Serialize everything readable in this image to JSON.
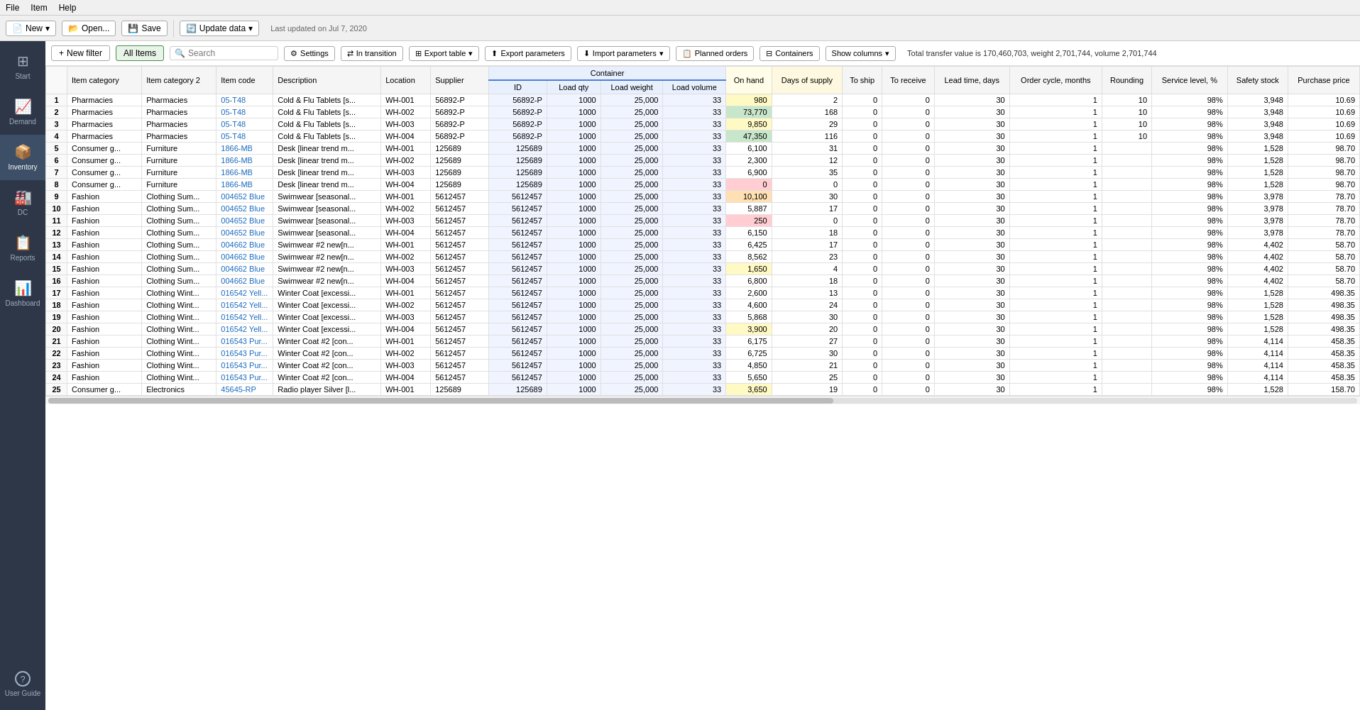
{
  "menu": {
    "file": "File",
    "item": "Item",
    "help": "Help"
  },
  "toolbar": {
    "new_label": "New",
    "open_label": "Open...",
    "save_label": "Save",
    "update_label": "Update data",
    "last_updated": "Last updated on Jul 7, 2020"
  },
  "sidebar": {
    "items": [
      {
        "id": "start",
        "label": "Start",
        "icon": "⊞"
      },
      {
        "id": "demand",
        "label": "Demand",
        "icon": "📈"
      },
      {
        "id": "inventory",
        "label": "Inventory",
        "icon": "📦",
        "active": true
      },
      {
        "id": "dc",
        "label": "DC",
        "icon": "🏭"
      },
      {
        "id": "reports",
        "label": "Reports",
        "icon": "📋"
      },
      {
        "id": "dashboard",
        "label": "Dashboard",
        "icon": "📊"
      }
    ],
    "bottom": [
      {
        "id": "user-guide",
        "label": "User Guide",
        "icon": "?"
      }
    ]
  },
  "filter_bar": {
    "new_filter": "New filter",
    "all_items": "All Items",
    "search_placeholder": "Search",
    "settings": "Settings",
    "in_transition": "In transition",
    "export_table": "Export table",
    "export_params": "Export parameters",
    "import_params": "Import parameters",
    "planned_orders": "Planned orders",
    "containers": "Containers",
    "show_columns": "Show columns",
    "info_text": "Total transfer value is 170,460,703, weight 2,701,744, volume 2,701,744"
  },
  "table": {
    "headers": {
      "row_num": "#",
      "item_category": "Item category",
      "item_category2": "Item category 2",
      "item_code": "Item code",
      "description": "Description",
      "location": "Location",
      "supplier": "Supplier",
      "container_label": "Container",
      "container_id": "ID",
      "load_qty": "Load qty",
      "load_weight": "Load weight",
      "load_volume": "Load volume",
      "on_hand": "On hand",
      "days_supply": "Days of supply",
      "to_ship": "To ship",
      "to_receive": "To receive",
      "lead_time": "Lead time, days",
      "order_cycle": "Order cycle, months",
      "rounding": "Rounding",
      "service_level": "Service level, %",
      "safety_stock": "Safety stock",
      "purchase_price": "Purchase price"
    },
    "rows": [
      {
        "num": 1,
        "cat": "Pharmacies",
        "cat2": "Pharmacies",
        "code": "05-T48",
        "desc": "Cold & Flu Tablets [s...",
        "loc": "WH-001",
        "sup": "56892-P",
        "cid": "56892-P",
        "lq": "1000",
        "lw": "25,000",
        "lv": "33",
        "on_hand": 980,
        "on_hand_color": "yellow",
        "days": 2,
        "ship": 0,
        "receive": 0,
        "lead": 30,
        "order": 1,
        "round": 10,
        "svc": "98%",
        "safety": 3948,
        "price": "10.69"
      },
      {
        "num": 2,
        "cat": "Pharmacies",
        "cat2": "Pharmacies",
        "code": "05-T48",
        "desc": "Cold & Flu Tablets [s...",
        "loc": "WH-002",
        "sup": "56892-P",
        "cid": "56892-P",
        "lq": "1000",
        "lw": "25,000",
        "lv": "33",
        "on_hand": 73770,
        "on_hand_color": "green",
        "days": 168,
        "ship": 0,
        "receive": 0,
        "lead": 30,
        "order": 1,
        "round": 10,
        "svc": "98%",
        "safety": 3948,
        "price": "10.69"
      },
      {
        "num": 3,
        "cat": "Pharmacies",
        "cat2": "Pharmacies",
        "code": "05-T48",
        "desc": "Cold & Flu Tablets [s...",
        "loc": "WH-003",
        "sup": "56892-P",
        "cid": "56892-P",
        "lq": "1000",
        "lw": "25,000",
        "lv": "33",
        "on_hand": 9850,
        "on_hand_color": "yellow",
        "days": 29,
        "ship": 0,
        "receive": 0,
        "lead": 30,
        "order": 1,
        "round": 10,
        "svc": "98%",
        "safety": 3948,
        "price": "10.69"
      },
      {
        "num": 4,
        "cat": "Pharmacies",
        "cat2": "Pharmacies",
        "code": "05-T48",
        "desc": "Cold & Flu Tablets [s...",
        "loc": "WH-004",
        "sup": "56892-P",
        "cid": "56892-P",
        "lq": "1000",
        "lw": "25,000",
        "lv": "33",
        "on_hand": 47350,
        "on_hand_color": "green",
        "days": 116,
        "ship": 0,
        "receive": 0,
        "lead": 30,
        "order": 1,
        "round": 10,
        "svc": "98%",
        "safety": 3948,
        "price": "10.69"
      },
      {
        "num": 5,
        "cat": "Consumer g...",
        "cat2": "Furniture",
        "code": "1866-MB",
        "desc": "Desk [linear trend m...",
        "loc": "WH-001",
        "sup": "125689",
        "cid": "125689",
        "lq": "1000",
        "lw": "25,000",
        "lv": "33",
        "on_hand": 6100,
        "on_hand_color": "white",
        "days": 31,
        "ship": 0,
        "receive": 0,
        "lead": 30,
        "order": 1,
        "round": "",
        "svc": "98%",
        "safety": 1528,
        "price": "98.70"
      },
      {
        "num": 6,
        "cat": "Consumer g...",
        "cat2": "Furniture",
        "code": "1866-MB",
        "desc": "Desk [linear trend m...",
        "loc": "WH-002",
        "sup": "125689",
        "cid": "125689",
        "lq": "1000",
        "lw": "25,000",
        "lv": "33",
        "on_hand": 2300,
        "on_hand_color": "white",
        "days": 12,
        "ship": 0,
        "receive": 0,
        "lead": 30,
        "order": 1,
        "round": "",
        "svc": "98%",
        "safety": 1528,
        "price": "98.70"
      },
      {
        "num": 7,
        "cat": "Consumer g...",
        "cat2": "Furniture",
        "code": "1866-MB",
        "desc": "Desk [linear trend m...",
        "loc": "WH-003",
        "sup": "125689",
        "cid": "125689",
        "lq": "1000",
        "lw": "25,000",
        "lv": "33",
        "on_hand": 6900,
        "on_hand_color": "white",
        "days": 35,
        "ship": 0,
        "receive": 0,
        "lead": 30,
        "order": 1,
        "round": "",
        "svc": "98%",
        "safety": 1528,
        "price": "98.70"
      },
      {
        "num": 8,
        "cat": "Consumer g...",
        "cat2": "Furniture",
        "code": "1866-MB",
        "desc": "Desk [linear trend m...",
        "loc": "WH-004",
        "sup": "125689",
        "cid": "125689",
        "lq": "1000",
        "lw": "25,000",
        "lv": "33",
        "on_hand": 0,
        "on_hand_color": "red",
        "days": 0,
        "ship": 0,
        "receive": 0,
        "lead": 30,
        "order": 1,
        "round": "",
        "svc": "98%",
        "safety": 1528,
        "price": "98.70"
      },
      {
        "num": 9,
        "cat": "Fashion",
        "cat2": "Clothing Sum...",
        "code": "004652 Blue",
        "desc": "Swimwear [seasonal...",
        "loc": "WH-001",
        "sup": "5612457",
        "cid": "5612457",
        "lq": "1000",
        "lw": "25,000",
        "lv": "33",
        "on_hand": 10100,
        "on_hand_color": "orange",
        "days": 30,
        "ship": 0,
        "receive": 0,
        "lead": 30,
        "order": 1,
        "round": "",
        "svc": "98%",
        "safety": 3978,
        "price": "78.70"
      },
      {
        "num": 10,
        "cat": "Fashion",
        "cat2": "Clothing Sum...",
        "code": "004652 Blue",
        "desc": "Swimwear [seasonal...",
        "loc": "WH-002",
        "sup": "5612457",
        "cid": "5612457",
        "lq": "1000",
        "lw": "25,000",
        "lv": "33",
        "on_hand": 5887,
        "on_hand_color": "white",
        "days": 17,
        "ship": 0,
        "receive": 0,
        "lead": 30,
        "order": 1,
        "round": "",
        "svc": "98%",
        "safety": 3978,
        "price": "78.70"
      },
      {
        "num": 11,
        "cat": "Fashion",
        "cat2": "Clothing Sum...",
        "code": "004652 Blue",
        "desc": "Swimwear [seasonal...",
        "loc": "WH-003",
        "sup": "5612457",
        "cid": "5612457",
        "lq": "1000",
        "lw": "25,000",
        "lv": "33",
        "on_hand": 250,
        "on_hand_color": "red",
        "days": 0,
        "ship": 0,
        "receive": 0,
        "lead": 30,
        "order": 1,
        "round": "",
        "svc": "98%",
        "safety": 3978,
        "price": "78.70"
      },
      {
        "num": 12,
        "cat": "Fashion",
        "cat2": "Clothing Sum...",
        "code": "004652 Blue",
        "desc": "Swimwear [seasonal...",
        "loc": "WH-004",
        "sup": "5612457",
        "cid": "5612457",
        "lq": "1000",
        "lw": "25,000",
        "lv": "33",
        "on_hand": 6150,
        "on_hand_color": "white",
        "days": 18,
        "ship": 0,
        "receive": 0,
        "lead": 30,
        "order": 1,
        "round": "",
        "svc": "98%",
        "safety": 3978,
        "price": "78.70"
      },
      {
        "num": 13,
        "cat": "Fashion",
        "cat2": "Clothing Sum...",
        "code": "004662 Blue",
        "desc": "Swimwear #2 new[n...",
        "loc": "WH-001",
        "sup": "5612457",
        "cid": "5612457",
        "lq": "1000",
        "lw": "25,000",
        "lv": "33",
        "on_hand": 6425,
        "on_hand_color": "white",
        "days": 17,
        "ship": 0,
        "receive": 0,
        "lead": 30,
        "order": 1,
        "round": "",
        "svc": "98%",
        "safety": 4402,
        "price": "58.70"
      },
      {
        "num": 14,
        "cat": "Fashion",
        "cat2": "Clothing Sum...",
        "code": "004662 Blue",
        "desc": "Swimwear #2 new[n...",
        "loc": "WH-002",
        "sup": "5612457",
        "cid": "5612457",
        "lq": "1000",
        "lw": "25,000",
        "lv": "33",
        "on_hand": 8562,
        "on_hand_color": "white",
        "days": 23,
        "ship": 0,
        "receive": 0,
        "lead": 30,
        "order": 1,
        "round": "",
        "svc": "98%",
        "safety": 4402,
        "price": "58.70"
      },
      {
        "num": 15,
        "cat": "Fashion",
        "cat2": "Clothing Sum...",
        "code": "004662 Blue",
        "desc": "Swimwear #2 new[n...",
        "loc": "WH-003",
        "sup": "5612457",
        "cid": "5612457",
        "lq": "1000",
        "lw": "25,000",
        "lv": "33",
        "on_hand": 1650,
        "on_hand_color": "yellow",
        "days": 4,
        "ship": 0,
        "receive": 0,
        "lead": 30,
        "order": 1,
        "round": "",
        "svc": "98%",
        "safety": 4402,
        "price": "58.70"
      },
      {
        "num": 16,
        "cat": "Fashion",
        "cat2": "Clothing Sum...",
        "code": "004662 Blue",
        "desc": "Swimwear #2 new[n...",
        "loc": "WH-004",
        "sup": "5612457",
        "cid": "5612457",
        "lq": "1000",
        "lw": "25,000",
        "lv": "33",
        "on_hand": 6800,
        "on_hand_color": "white",
        "days": 18,
        "ship": 0,
        "receive": 0,
        "lead": 30,
        "order": 1,
        "round": "",
        "svc": "98%",
        "safety": 4402,
        "price": "58.70"
      },
      {
        "num": 17,
        "cat": "Fashion",
        "cat2": "Clothing Wint...",
        "code": "016542 Yell...",
        "desc": "Winter Coat [excessi...",
        "loc": "WH-001",
        "sup": "5612457",
        "cid": "5612457",
        "lq": "1000",
        "lw": "25,000",
        "lv": "33",
        "on_hand": 2600,
        "on_hand_color": "white",
        "days": 13,
        "ship": 0,
        "receive": 0,
        "lead": 30,
        "order": 1,
        "round": "",
        "svc": "98%",
        "safety": 1528,
        "price": "498.35"
      },
      {
        "num": 18,
        "cat": "Fashion",
        "cat2": "Clothing Wint...",
        "code": "016542 Yell...",
        "desc": "Winter Coat [excessi...",
        "loc": "WH-002",
        "sup": "5612457",
        "cid": "5612457",
        "lq": "1000",
        "lw": "25,000",
        "lv": "33",
        "on_hand": 4600,
        "on_hand_color": "white",
        "days": 24,
        "ship": 0,
        "receive": 0,
        "lead": 30,
        "order": 1,
        "round": "",
        "svc": "98%",
        "safety": 1528,
        "price": "498.35"
      },
      {
        "num": 19,
        "cat": "Fashion",
        "cat2": "Clothing Wint...",
        "code": "016542 Yell...",
        "desc": "Winter Coat [excessi...",
        "loc": "WH-003",
        "sup": "5612457",
        "cid": "5612457",
        "lq": "1000",
        "lw": "25,000",
        "lv": "33",
        "on_hand": 5868,
        "on_hand_color": "white",
        "days": 30,
        "ship": 0,
        "receive": 0,
        "lead": 30,
        "order": 1,
        "round": "",
        "svc": "98%",
        "safety": 1528,
        "price": "498.35"
      },
      {
        "num": 20,
        "cat": "Fashion",
        "cat2": "Clothing Wint...",
        "code": "016542 Yell...",
        "desc": "Winter Coat [excessi...",
        "loc": "WH-004",
        "sup": "5612457",
        "cid": "5612457",
        "lq": "1000",
        "lw": "25,000",
        "lv": "33",
        "on_hand": 3900,
        "on_hand_color": "yellow",
        "days": 20,
        "ship": 0,
        "receive": 0,
        "lead": 30,
        "order": 1,
        "round": "",
        "svc": "98%",
        "safety": 1528,
        "price": "498.35"
      },
      {
        "num": 21,
        "cat": "Fashion",
        "cat2": "Clothing Wint...",
        "code": "016543 Pur...",
        "desc": "Winter Coat #2 [con...",
        "loc": "WH-001",
        "sup": "5612457",
        "cid": "5612457",
        "lq": "1000",
        "lw": "25,000",
        "lv": "33",
        "on_hand": 6175,
        "on_hand_color": "white",
        "days": 27,
        "ship": 0,
        "receive": 0,
        "lead": 30,
        "order": 1,
        "round": "",
        "svc": "98%",
        "safety": 4114,
        "price": "458.35"
      },
      {
        "num": 22,
        "cat": "Fashion",
        "cat2": "Clothing Wint...",
        "code": "016543 Pur...",
        "desc": "Winter Coat #2 [con...",
        "loc": "WH-002",
        "sup": "5612457",
        "cid": "5612457",
        "lq": "1000",
        "lw": "25,000",
        "lv": "33",
        "on_hand": 6725,
        "on_hand_color": "white",
        "days": 30,
        "ship": 0,
        "receive": 0,
        "lead": 30,
        "order": 1,
        "round": "",
        "svc": "98%",
        "safety": 4114,
        "price": "458.35"
      },
      {
        "num": 23,
        "cat": "Fashion",
        "cat2": "Clothing Wint...",
        "code": "016543 Pur...",
        "desc": "Winter Coat #2 [con...",
        "loc": "WH-003",
        "sup": "5612457",
        "cid": "5612457",
        "lq": "1000",
        "lw": "25,000",
        "lv": "33",
        "on_hand": 4850,
        "on_hand_color": "white",
        "days": 21,
        "ship": 0,
        "receive": 0,
        "lead": 30,
        "order": 1,
        "round": "",
        "svc": "98%",
        "safety": 4114,
        "price": "458.35"
      },
      {
        "num": 24,
        "cat": "Fashion",
        "cat2": "Clothing Wint...",
        "code": "016543 Pur...",
        "desc": "Winter Coat #2 [con...",
        "loc": "WH-004",
        "sup": "5612457",
        "cid": "5612457",
        "lq": "1000",
        "lw": "25,000",
        "lv": "33",
        "on_hand": 5650,
        "on_hand_color": "white",
        "days": 25,
        "ship": 0,
        "receive": 0,
        "lead": 30,
        "order": 1,
        "round": "",
        "svc": "98%",
        "safety": 4114,
        "price": "458.35"
      },
      {
        "num": 25,
        "cat": "Consumer g...",
        "cat2": "Electronics",
        "code": "45645-RP",
        "desc": "Radio player Silver [l...",
        "loc": "WH-001",
        "sup": "125689",
        "cid": "125689",
        "lq": "1000",
        "lw": "25,000",
        "lv": "33",
        "on_hand": 3650,
        "on_hand_color": "yellow",
        "days": 19,
        "ship": 0,
        "receive": 0,
        "lead": 30,
        "order": 1,
        "round": "",
        "svc": "98%",
        "safety": 1528,
        "price": "158.70"
      }
    ]
  }
}
